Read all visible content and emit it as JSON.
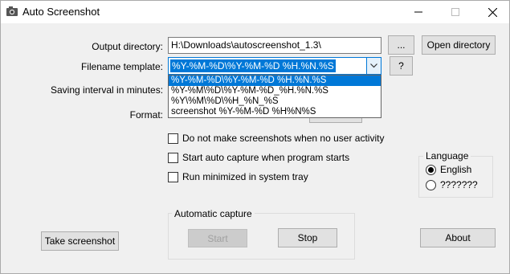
{
  "window": {
    "title": "Auto Screenshot",
    "icon": "camera-icon"
  },
  "form": {
    "output_directory_label": "Output directory:",
    "output_directory_value": "H:\\Downloads\\autoscreenshot_1.3\\",
    "browse_label": "...",
    "open_directory_label": "Open directory",
    "filename_template_label": "Filename template:",
    "filename_template_value": "%Y-%M-%D\\%Y-%M-%D %H.%N.%S",
    "help_label": "?",
    "saving_interval_label": "Saving interval in minutes:",
    "format_label": "Format:"
  },
  "template_options": [
    "%Y-%M-%D\\%Y-%M-%D %H.%N.%S",
    "%Y-%M\\%D\\%Y-%M-%D_%H.%N.%S",
    "%Y\\%M\\%D\\%H_%N_%S",
    "screenshot %Y-%M-%D %H%N%S"
  ],
  "options": {
    "no_activity_label": "Do not make screenshots when no user activity",
    "no_activity_checked": false,
    "auto_start_label": "Start auto capture when program starts",
    "auto_start_checked": false,
    "minimized_label": "Run minimized in system tray",
    "minimized_checked": false
  },
  "language": {
    "group_label": "Language",
    "options": [
      "English",
      "???????"
    ],
    "selected": "English"
  },
  "automatic_capture": {
    "group_label": "Automatic capture",
    "start_label": "Start",
    "stop_label": "Stop"
  },
  "buttons": {
    "take_screenshot_label": "Take screenshot",
    "about_label": "About"
  }
}
